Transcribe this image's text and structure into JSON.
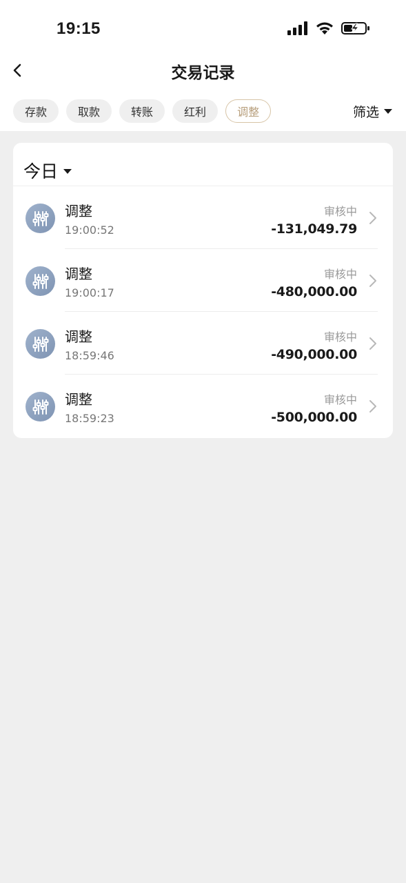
{
  "status_bar": {
    "time": "19:15"
  },
  "nav": {
    "title": "交易记录"
  },
  "tabs": [
    {
      "label": "存款",
      "active": false
    },
    {
      "label": "取款",
      "active": false
    },
    {
      "label": "转账",
      "active": false
    },
    {
      "label": "红利",
      "active": false
    },
    {
      "label": "调整",
      "active": true
    }
  ],
  "filter": {
    "label": "筛选"
  },
  "period": {
    "label": "今日"
  },
  "records": [
    {
      "type": "调整",
      "time": "19:00:52",
      "status": "审核中",
      "amount": "-131,049.79"
    },
    {
      "type": "调整",
      "time": "19:00:17",
      "status": "审核中",
      "amount": "-480,000.00"
    },
    {
      "type": "调整",
      "time": "18:59:46",
      "status": "审核中",
      "amount": "-490,000.00"
    },
    {
      "type": "调整",
      "time": "18:59:23",
      "status": "审核中",
      "amount": "-500,000.00"
    }
  ],
  "colors": {
    "accent_border": "#d7c4a6",
    "accent_text": "#b79e7b",
    "icon_bg": "#8fa3c0",
    "page_bg": "#efefef"
  }
}
